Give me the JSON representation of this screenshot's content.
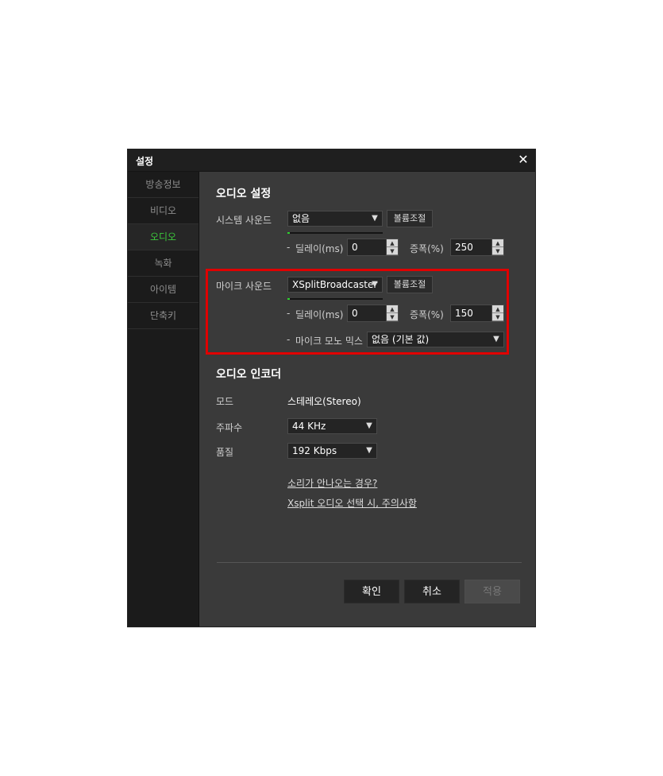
{
  "window": {
    "title": "설정",
    "close_glyph": "✕"
  },
  "sidebar": {
    "items": [
      {
        "label": "방송정보"
      },
      {
        "label": "비디오"
      },
      {
        "label": "오디오"
      },
      {
        "label": "녹화"
      },
      {
        "label": "아이템"
      },
      {
        "label": "단축키"
      }
    ],
    "active_index": 2
  },
  "audio_settings": {
    "heading": "오디오 설정",
    "system_sound": {
      "label": "시스템 사운드",
      "device": "없음",
      "volume_button": "볼륨조절",
      "delay_label": "딜레이(ms)",
      "delay_value": "0",
      "gain_label": "증폭(%)",
      "gain_value": "250"
    },
    "mic_sound": {
      "label": "마이크 사운드",
      "device": "XSplitBroadcaster",
      "volume_button": "볼륨조절",
      "delay_label": "딜레이(ms)",
      "delay_value": "0",
      "gain_label": "증폭(%)",
      "gain_value": "150",
      "mono_mix_label": "마이크 모노 믹스",
      "mono_mix_value": "없음 (기본 값)"
    },
    "dash": "-"
  },
  "audio_encoder": {
    "heading": "오디오 인코더",
    "mode_label": "모드",
    "mode_value": "스테레오(Stereo)",
    "frequency_label": "주파수",
    "frequency_value": "44 KHz",
    "quality_label": "품질",
    "quality_value": "192 Kbps"
  },
  "links": {
    "no_sound": "소리가 안나오는 경우?",
    "xsplit_notice": "Xsplit 오디오 선택 시, 주의사항"
  },
  "footer": {
    "confirm": "확인",
    "cancel": "취소",
    "apply": "적용"
  },
  "colors": {
    "accent": "#3cc83c",
    "highlight_border": "#e00000"
  },
  "icons": {
    "dropdown": "chevron-down-icon",
    "spin_up": "caret-up-icon",
    "spin_down": "caret-down-icon",
    "close": "close-icon"
  }
}
